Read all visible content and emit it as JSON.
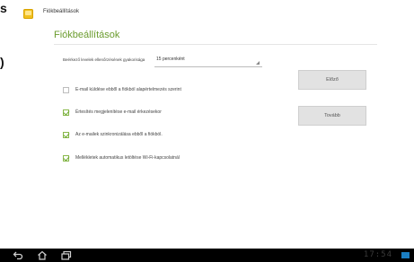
{
  "edge": {
    "chars": [
      "s",
      ")"
    ]
  },
  "app": {
    "title": "Fiókbeállítások"
  },
  "page": {
    "title": "Fiókbeállítások"
  },
  "frequency": {
    "label": "Beérkező levelek ellenőrzésének gyakorisága",
    "value": "15 percenként"
  },
  "options": [
    {
      "label": "E-mail küldése ebből a fiókból alapértelmezés szerint",
      "checked": false
    },
    {
      "label": "Értesítés megjelenítése e-mail érkezésekor",
      "checked": true
    },
    {
      "label": "Az e-mailek szinkronizálása ebből a fiókból.",
      "checked": true
    },
    {
      "label": "Mellékletek automatikus letöltése Wi-Fi-kapcsolatnál",
      "checked": true
    }
  ],
  "buttons": {
    "prev": "Előző",
    "next": "Tovább"
  },
  "statusbar": {
    "time": "17:54"
  },
  "colors": {
    "accent": "#6b9c2e",
    "navbar": "#000000"
  }
}
